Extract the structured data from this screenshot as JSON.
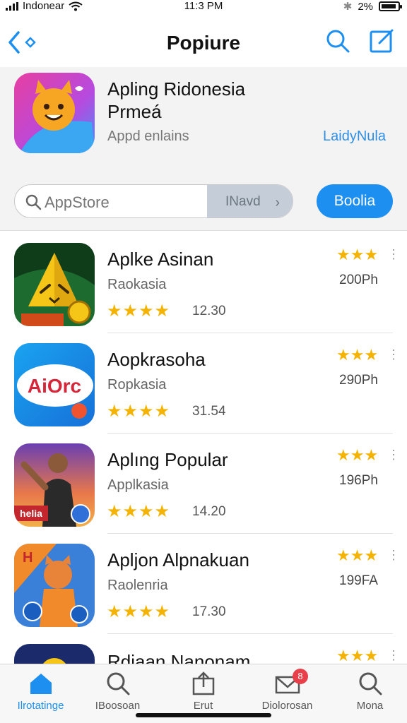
{
  "status_bar": {
    "carrier": "Indonear",
    "time": "11:3 PM",
    "battery": "2%"
  },
  "nav": {
    "title": "Popiure"
  },
  "featured": {
    "title": "Apling Ridonesia Prmeá",
    "subtitle": "Appd enlains",
    "link": "LaidyNula"
  },
  "search": {
    "placeholder": "AppStore",
    "segment_label": "INavd",
    "button_label": "Boolia"
  },
  "apps": [
    {
      "name": "Aplke Asinan",
      "category": "Raokasia",
      "count": "12.30",
      "size": "200Ph",
      "stars": "★★★★",
      "rating_stars": "★★★"
    },
    {
      "name": "Aopkrasoha",
      "category": "Ropkasia",
      "count": "31.54",
      "size": "290Ph",
      "stars": "★★★★",
      "rating_stars": "★★★",
      "icon_text": "AiOrc"
    },
    {
      "name": "Aplıng Popular",
      "category": "Applkasia",
      "count": "14.20",
      "size": "196Ph",
      "stars": "★★★★",
      "rating_stars": "★★★",
      "icon_text": "helia"
    },
    {
      "name": "Apljon Alpnakuan",
      "category": "Raolenria",
      "count": "17.30",
      "size": "199FA",
      "stars": "★★★★",
      "rating_stars": "★★★",
      "icon_text": "H"
    },
    {
      "name": "Rdiaan Nanonam",
      "rating_stars": "★★★"
    }
  ],
  "tabs": [
    {
      "label": "Ilrotatinge",
      "icon": "home-icon"
    },
    {
      "label": "IBoosoan",
      "icon": "search-icon"
    },
    {
      "label": "Erut",
      "icon": "share-icon"
    },
    {
      "label": "Diolorosan",
      "icon": "mail-icon",
      "badge": "8"
    },
    {
      "label": "Mona",
      "icon": "search-icon"
    }
  ],
  "colors": {
    "accent": "#1d8ff0",
    "star": "#f5b301",
    "badge": "#e8404a"
  }
}
